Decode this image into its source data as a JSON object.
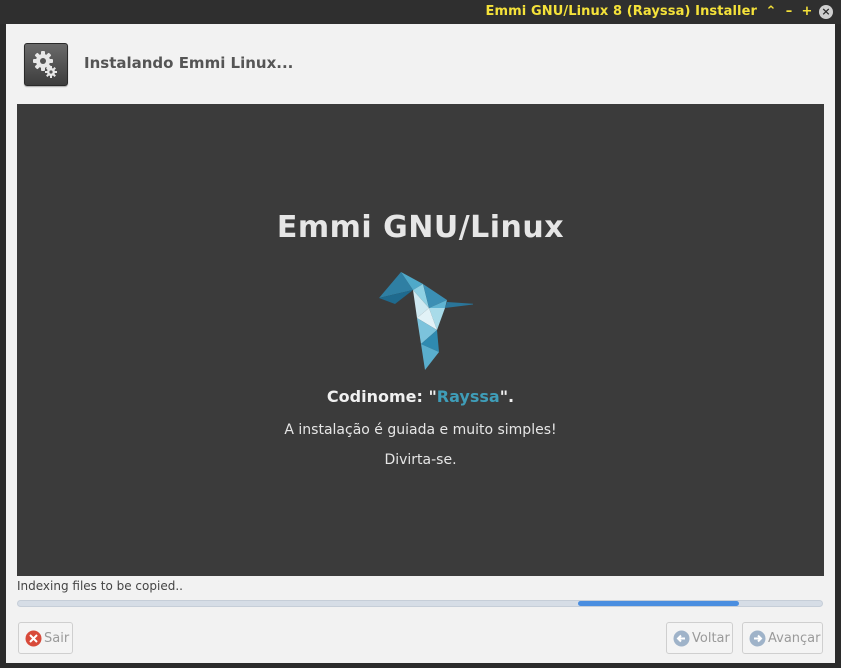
{
  "window": {
    "title": "Emmi GNU/Linux 8 (Rayssa) Installer",
    "controls": {
      "shade": "⌃",
      "minimize": "–",
      "maximize": "+",
      "close": "×"
    }
  },
  "header": {
    "title": "Instalando Emmi Linux...",
    "icon": "gears-icon"
  },
  "slide": {
    "title": "Emmi GNU/Linux",
    "logo": "hummingbird-logo",
    "codename_prefix": "Codinome: \"",
    "codename": "Rayssa",
    "codename_suffix": "\".",
    "line1": "A instalação é guiada e muito simples!",
    "line2": "Divirta-se."
  },
  "status": {
    "text": "Indexing files to be copied..",
    "progress_color": "#4a8ee0"
  },
  "buttons": {
    "quit": "Sair",
    "back": "Voltar",
    "next": "Avançar"
  },
  "colors": {
    "title_accent": "#f5e23a",
    "codename_accent": "#3f9db8"
  }
}
